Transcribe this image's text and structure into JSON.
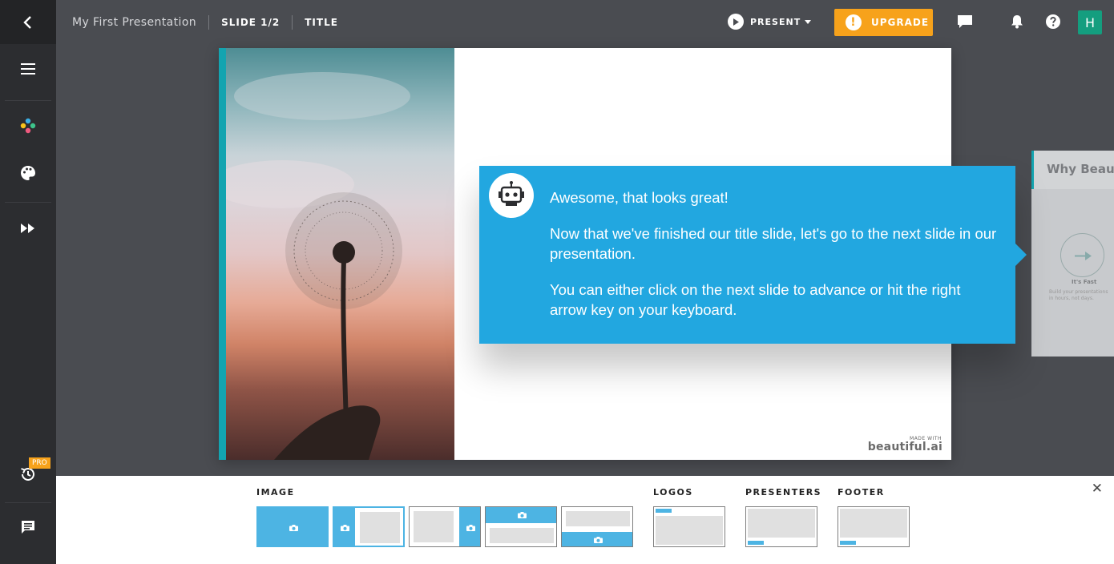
{
  "topbar": {
    "presentation_title": "My First Presentation",
    "slide_counter": "SLIDE 1/2",
    "slide_type": "TITLE",
    "present_label": "PRESENT",
    "upgrade_label": "UPGRADE",
    "avatar_initial": "H"
  },
  "sidebar": {
    "pro_badge": "PRO"
  },
  "slide": {
    "made_with": "MADE WITH",
    "brand": "beautiful.ai"
  },
  "next_slide": {
    "title": "Why Beautiful",
    "feature_label": "It's Fast",
    "feature_sub": "Build your presentations in hours, not days."
  },
  "callout": {
    "line1": "Awesome, that looks great!",
    "line2": "Now that we've finished our title slide, let's go to the next slide in our presentation.",
    "line3": "You can either click on the next slide to advance or hit the right arrow key on your keyboard."
  },
  "bottom_panel": {
    "image_label": "IMAGE",
    "logos_label": "LOGOS",
    "presenters_label": "PRESENTERS",
    "footer_label": "FOOTER"
  },
  "colors": {
    "accent_teal": "#13a4b0",
    "callout_blue": "#22a7e0",
    "upgrade_orange": "#f7a21b",
    "avatar_green": "#149e7f"
  }
}
